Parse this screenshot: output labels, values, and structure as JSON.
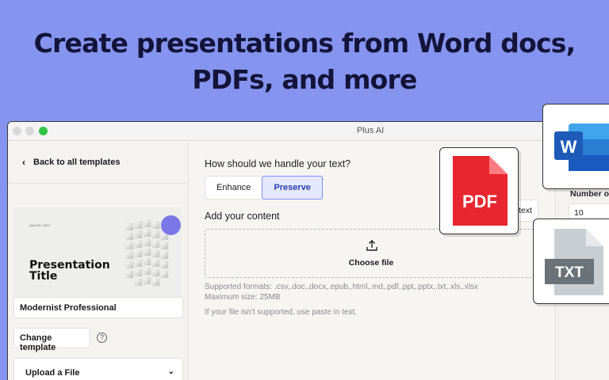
{
  "headline": "Create presentations from Word docs, PDFs, and more",
  "window": {
    "title": "Plus AI"
  },
  "sidebar": {
    "back_label": "Back to all templates",
    "template_preview": {
      "date": "April 2th, 2024",
      "title": "Presentation Title"
    },
    "template_name": "Modernist Professional",
    "change_template": "Change template",
    "help_glyph": "?",
    "upload_dropdown": "Upload a File"
  },
  "main": {
    "text_question": "How should we handle your text?",
    "text_modes": [
      "Enhance",
      "Preserve"
    ],
    "selected_mode": "Preserve",
    "add_content_label": "Add your content",
    "choose_file": "Choose file",
    "supported_formats": "Supported formats: .csv,.doc,.docx,.epub,.html,.md,.pdf,.ppt,.pptx,.txt,.xls,.xlsx",
    "max_size": "Maximum size: 25MB",
    "unsupported_note": "If your file isn't supported, use paste in text.",
    "paste_tab_fragment": "text"
  },
  "right_panel": {
    "slides_label": "Number of sl",
    "slides_value": "10"
  },
  "file_badges": {
    "pdf": {
      "label": "PDF",
      "color": "#e8262f"
    },
    "word": {
      "label": "W",
      "color": "#1e5bb8"
    },
    "txt": {
      "label": "TXT",
      "color": "#6b7378"
    }
  },
  "colors": {
    "background": "#8594ef",
    "accent": "#7f8ff3"
  }
}
